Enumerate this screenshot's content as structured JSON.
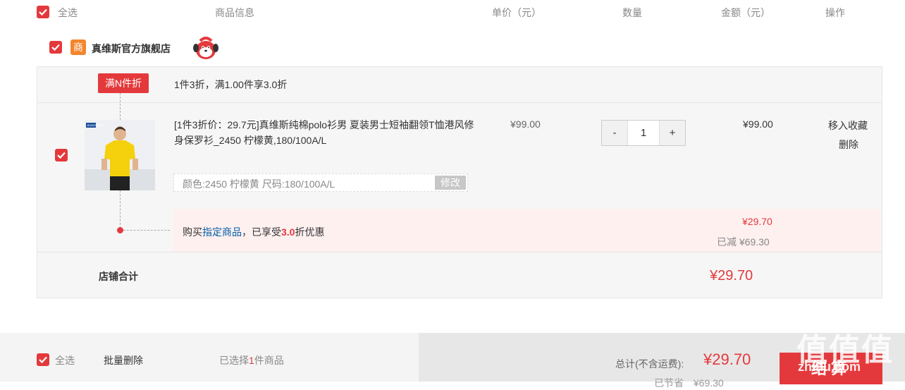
{
  "header": {
    "select_all": "全选",
    "product_info": "商品信息",
    "unit_price": "单价（元）",
    "quantity": "数量",
    "amount": "金额（元）",
    "action": "操作"
  },
  "shop": {
    "badge": "商",
    "name": "真维斯官方旗舰店",
    "mascot_icon": "jd-joy-mascot-icon"
  },
  "promotion": {
    "tag": "满N件折",
    "desc": "1件3折，满1.00件享3.0折"
  },
  "item": {
    "title": "[1件3折价：29.7元]真维斯纯棉polo衫男 夏装男士短袖翻领T恤港风修身保罗衫_2450 柠檬黄,180/100A/L",
    "thumb_brand": "JEANSWEST",
    "spec": "颜色:2450 柠檬黄   尺码:180/100A/L",
    "spec_edit": "修改",
    "price": "¥99.00",
    "qty_minus": "-",
    "qty_value": "1",
    "qty_plus": "+",
    "subtotal": "¥99.00",
    "move_to_fav": "移入收藏",
    "delete": "删除"
  },
  "discount": {
    "prefix": "购买",
    "link": "指定商品",
    "middle": "，已享受",
    "rate": "3.0",
    "suffix": "折优惠",
    "final_price": "¥29.70",
    "saved": "已减 ¥69.30"
  },
  "shop_total": {
    "label": "店铺合计",
    "value": "¥29.70"
  },
  "footer": {
    "select_all": "全选",
    "batch_delete": "批量删除",
    "selected_prefix": "已选择",
    "selected_count": "1",
    "selected_suffix": "件商品",
    "total_label": "总计(不含运费):",
    "total_value": "¥29.70",
    "saved_partial": "已节省",
    "saved_value": "¥69.30",
    "checkout": "结算"
  },
  "watermark": {
    "big": "值值值",
    "small": "zhihu.com"
  },
  "colors": {
    "accent": "#e4393c",
    "link": "#005ea7",
    "shop_badge": "#f2862e"
  }
}
